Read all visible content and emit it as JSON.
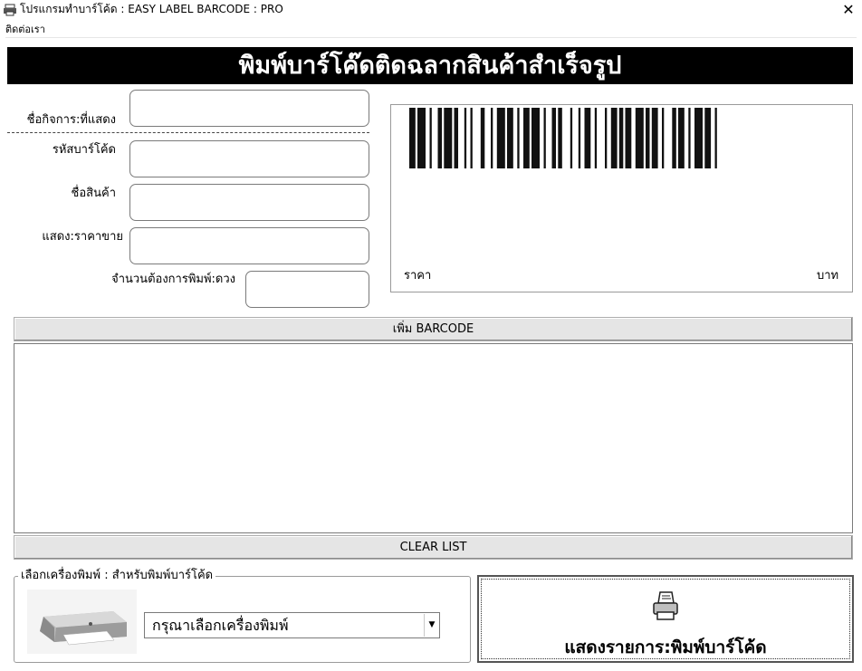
{
  "window": {
    "title": "โปรแกรมทำบาร์โค้ด : EASY LABEL BARCODE : PRO",
    "close_glyph": "✕"
  },
  "menu": {
    "contact": "ติดต่อเรา"
  },
  "banner": {
    "title": "พิมพ์บาร์โค๊ดติดฉลากสินค้าสำเร็จรูป"
  },
  "form": {
    "business_label": "ชื่อกิจการ:ที่แสดง",
    "barcode_label": "รหัสบาร์โค้ด",
    "product_label": "ชื่อสินค้า",
    "price_label": "แสดง:ราคาขาย",
    "quantity_label": "จำนวนต้องการพิมพ์:ดวง",
    "business_value": "",
    "barcode_value": "",
    "product_value": "",
    "price_value": "",
    "quantity_value": ""
  },
  "preview": {
    "price_text": "ราคา",
    "currency_text": "บาท"
  },
  "buttons": {
    "add_barcode": "เพิ่ม BARCODE",
    "clear_list": "CLEAR LIST",
    "print": "แสดงรายการ:พิมพ์บาร์โค้ด"
  },
  "printer": {
    "group_label": "เลือกเครื่องพิมพ์ : สำหรับพิมพ์บาร์โค้ด",
    "selected": "กรุณาเลือกเครื่องพิมพ์",
    "arrow_glyph": "▼"
  },
  "icons": {
    "app": "printer-app-icon",
    "print": "printer-icon",
    "printer_photo": "inkjet-printer-image",
    "dropdown": "chevron-down-icon"
  }
}
